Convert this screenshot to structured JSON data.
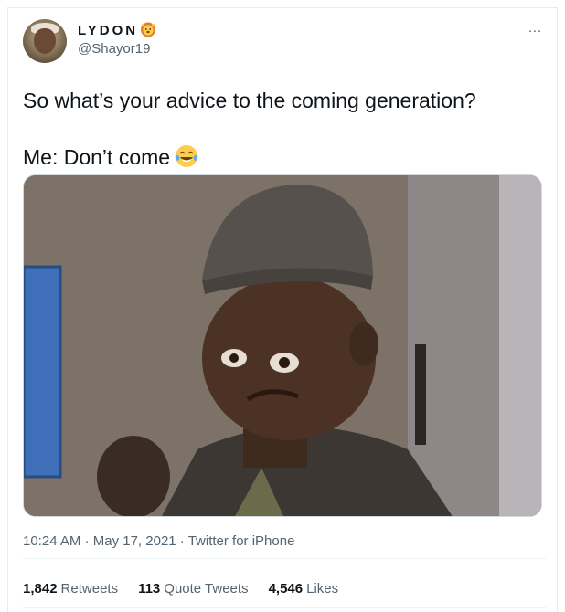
{
  "tweet": {
    "author": {
      "display_name": "LYDON",
      "name_emoji": "lion-face-icon",
      "handle": "@Shayor19"
    },
    "more_icon": "more-icon",
    "more_label": "···",
    "text_line1": "So what’s your advice to the coming generation?",
    "text_line2": "Me: Don’t come",
    "text_emoji": "face-with-tears-of-joy-icon",
    "time": "10:24 AM",
    "dot1": " · ",
    "date": "May 17, 2021",
    "dot2": " · ",
    "source": "Twitter for iPhone",
    "stats": {
      "retweets": "1,842",
      "retweets_label": "Retweets",
      "quotes": "113",
      "quotes_label": "Quote Tweets",
      "likes": "4,546",
      "likes_label": "Likes"
    }
  },
  "colors": {
    "text": "#0f1419",
    "secondary": "#536471",
    "border": "#eff3f4"
  }
}
